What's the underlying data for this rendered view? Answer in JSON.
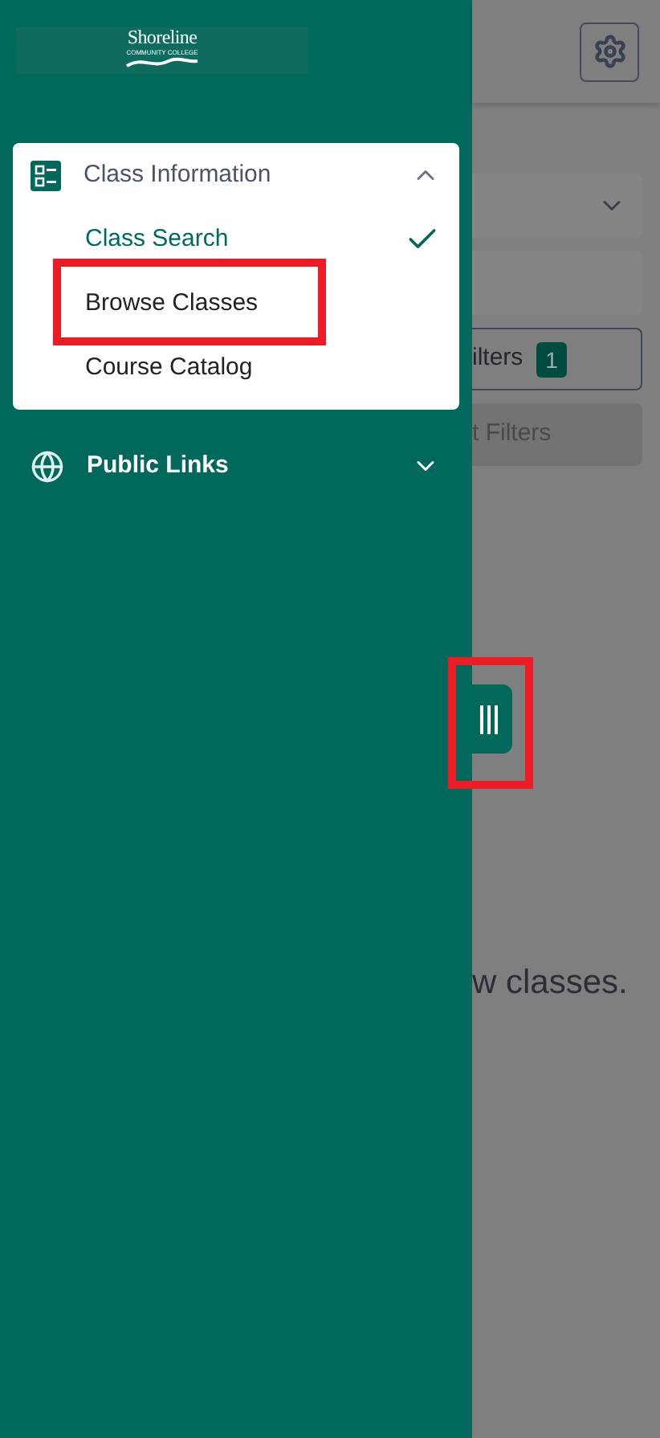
{
  "logo": {
    "name": "Shoreline",
    "tagline": "COMMUNITY COLLEGE"
  },
  "menu": [
    {
      "label": "Class Information",
      "kind": "list",
      "expanded": true,
      "children": [
        {
          "label": "Class Search",
          "selected": true,
          "highlighted": false
        },
        {
          "label": "Browse Classes",
          "selected": false,
          "highlighted": true
        },
        {
          "label": "Course Catalog",
          "selected": false,
          "highlighted": false
        }
      ]
    },
    {
      "label": "Public Links",
      "kind": "globe",
      "expanded": false
    }
  ],
  "handle": {
    "highlighted": true
  },
  "background": {
    "filters_button": "ilters",
    "filter_count": "1",
    "reset_button": "t Filters",
    "message": "w classes."
  }
}
